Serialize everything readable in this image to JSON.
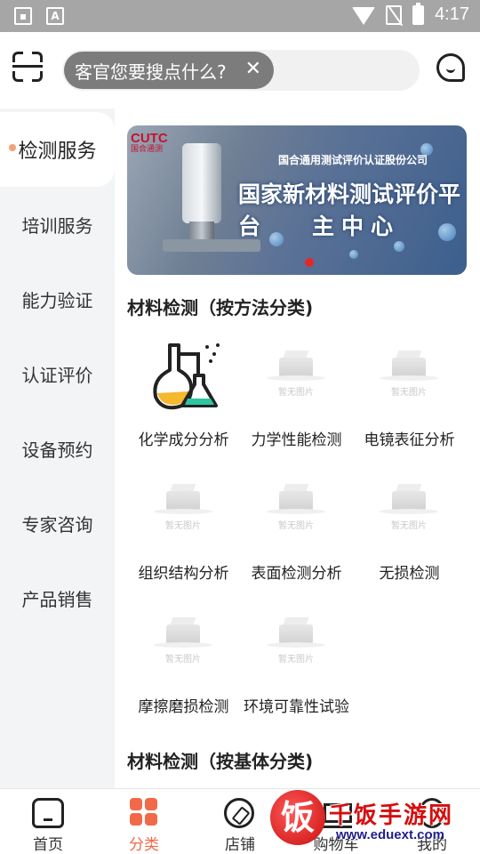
{
  "status_bar": {
    "time": "4:17",
    "left_icons": [
      "image-icon",
      "font-a-icon"
    ],
    "font_icon_text": "A",
    "right_icons": [
      "wifi-icon",
      "no-sim-icon",
      "battery-icon"
    ]
  },
  "header": {
    "search_text": "客官您要搜点什么?",
    "search_clear": "✕"
  },
  "sidebar": {
    "items": [
      {
        "label": "检测服务",
        "active": true
      },
      {
        "label": "培训服务"
      },
      {
        "label": "能力验证"
      },
      {
        "label": "认证评价"
      },
      {
        "label": "设备预约"
      },
      {
        "label": "专家咨询"
      },
      {
        "label": "产品销售"
      }
    ]
  },
  "banner": {
    "logo": "CUTC",
    "logo_sub": "国合通测",
    "company": "国合通用测试评价认证股份公司",
    "title_line1": "国家新材料测试评价平台",
    "title_line2": "主中心",
    "indicator_color": "#e8262a"
  },
  "sections": [
    {
      "title": "材料检测（按方法分类)",
      "items": [
        {
          "label": "化学成分分析",
          "icon": "chemistry-flask-icon"
        },
        {
          "label": "力学性能检测",
          "placeholder": "暂无图片"
        },
        {
          "label": "电镜表征分析",
          "placeholder": "暂无图片"
        },
        {
          "label": "组织结构分析",
          "placeholder": "暂无图片"
        },
        {
          "label": "表面检测分析",
          "placeholder": "暂无图片"
        },
        {
          "label": "无损检测",
          "placeholder": "暂无图片"
        },
        {
          "label": "摩擦磨损检测",
          "placeholder": "暂无图片"
        },
        {
          "label": "环境可靠性试验",
          "placeholder": "暂无图片"
        }
      ]
    },
    {
      "title": "材料检测（按基体分类)"
    }
  ],
  "bottom_nav": {
    "items": [
      {
        "label": "首页",
        "icon": "home-icon"
      },
      {
        "label": "分类",
        "icon": "category-icon",
        "active": true
      },
      {
        "label": "店铺",
        "icon": "compass-icon"
      },
      {
        "label": "购物车",
        "icon": "cart-icon"
      },
      {
        "label": "我的",
        "icon": "profile-icon"
      }
    ]
  },
  "watermark": {
    "logo_char": "饭",
    "name": "千饭手游网",
    "url": "www.eduext.com"
  },
  "colors": {
    "accent": "#f2694a",
    "sidebar_bg": "#f3f4f6",
    "status_bar": "#a6a6a6"
  }
}
